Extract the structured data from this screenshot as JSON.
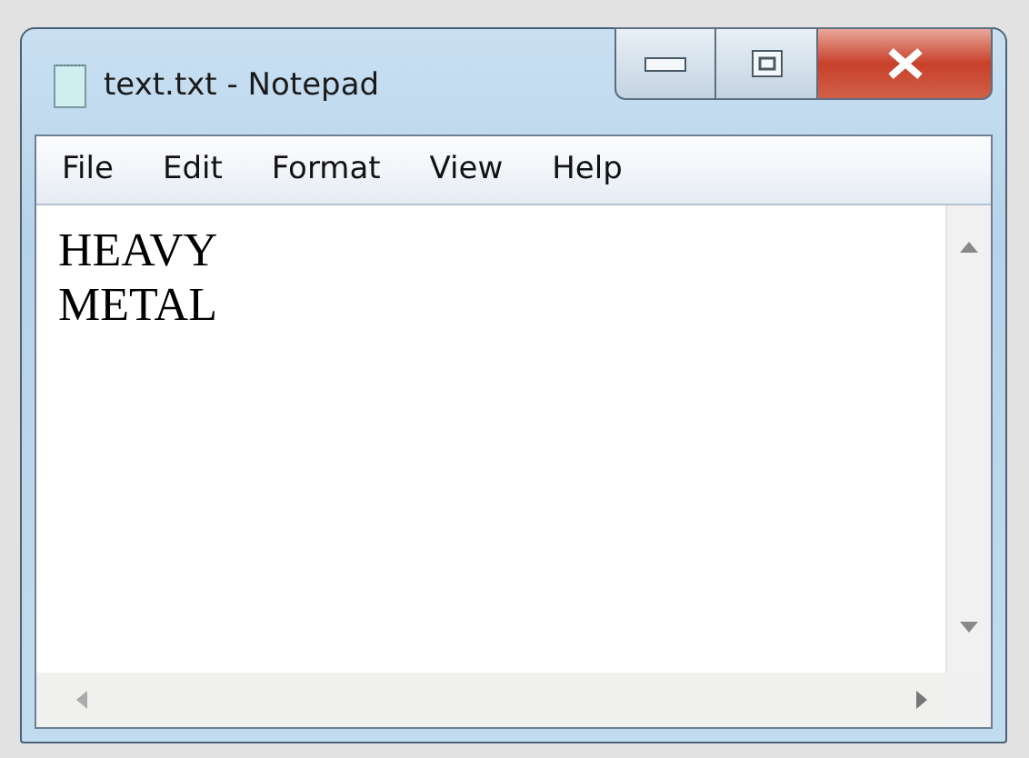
{
  "window": {
    "title": "text.txt - Notepad"
  },
  "menu": [
    "File",
    "Edit",
    "Format",
    "View",
    "Help"
  ],
  "document": {
    "lines": [
      "HEAVY",
      "METAL"
    ]
  }
}
